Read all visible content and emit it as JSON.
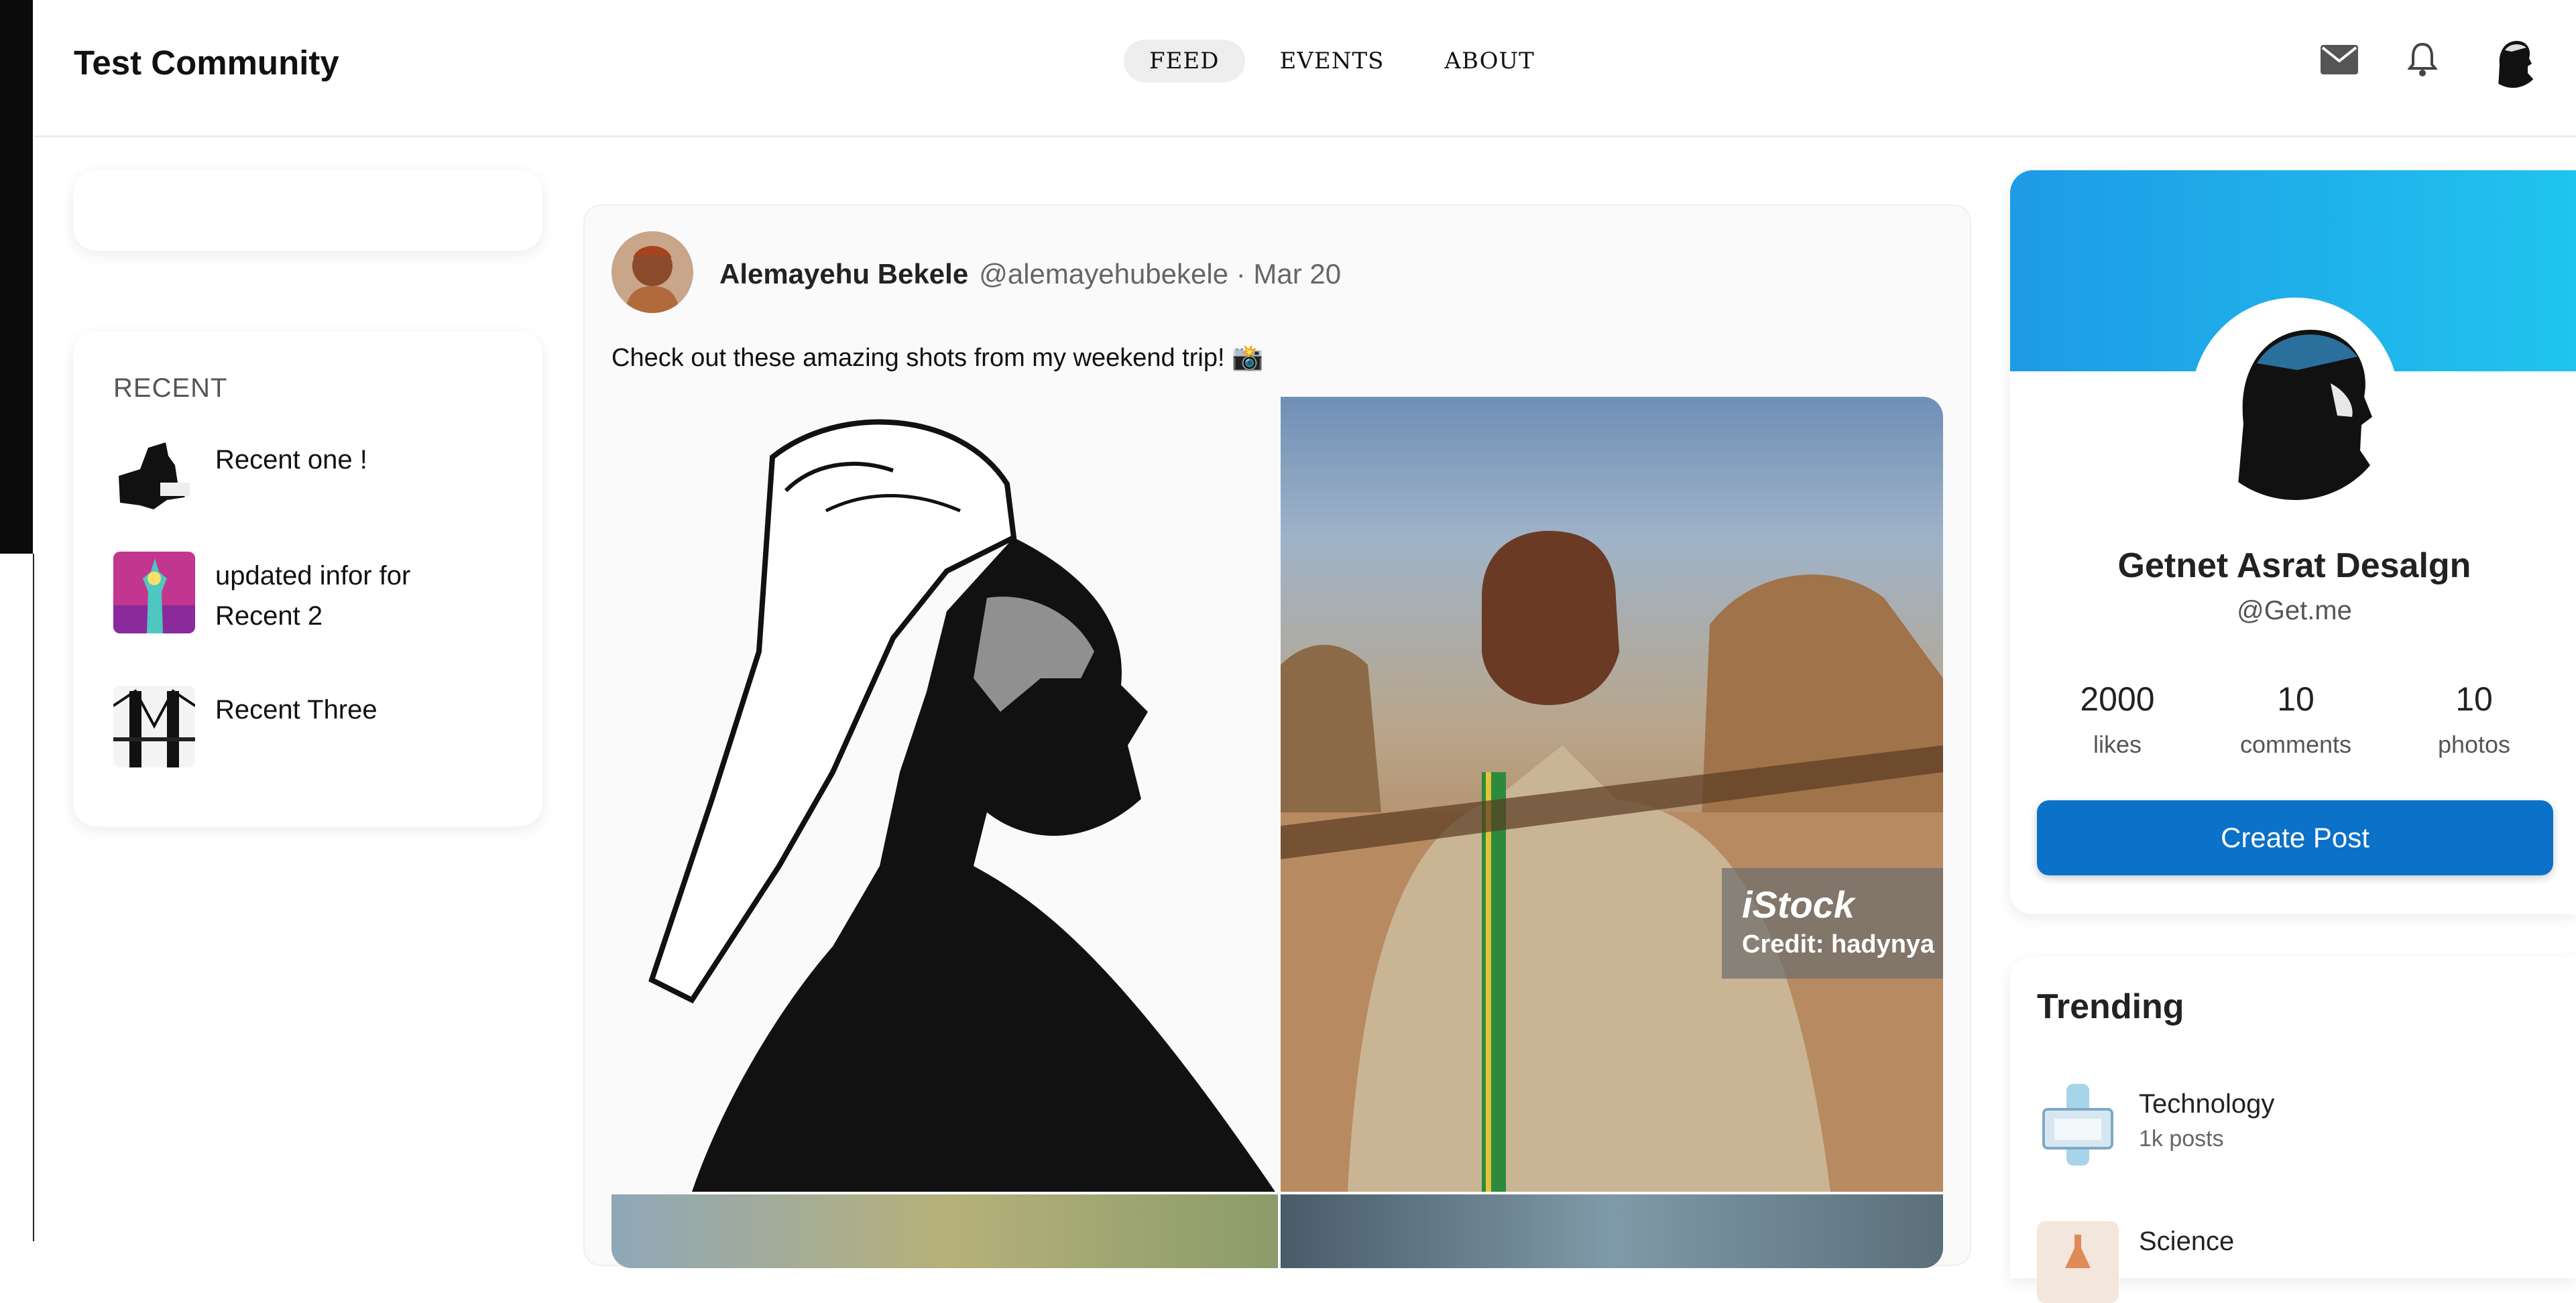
{
  "header": {
    "brand": "Test Community",
    "nav": [
      {
        "label": "FEED",
        "active": true
      },
      {
        "label": "EVENTS",
        "active": false
      },
      {
        "label": "ABOUT",
        "active": false
      }
    ],
    "icons": [
      "mail-icon",
      "bell-icon",
      "user-avatar"
    ]
  },
  "recent": {
    "title": "RECENT",
    "items": [
      {
        "label": "Recent one !"
      },
      {
        "label": "updated infor for Recent 2"
      },
      {
        "label": "Recent Three"
      }
    ]
  },
  "post": {
    "author": "Alemayehu Bekele",
    "handle": "@alemayehubekele",
    "separator": "·",
    "date": "Mar 20",
    "text": "Check out these amazing shots from my weekend trip! 📸",
    "watermark": {
      "brand": "iStock",
      "credit": "Credit: hadynya"
    }
  },
  "profile": {
    "name": "Getnet Asrat Desalgn",
    "handle": "@Get.me",
    "stats": [
      {
        "value": "2000",
        "label": "likes"
      },
      {
        "value": "10",
        "label": "comments"
      },
      {
        "value": "10",
        "label": "photos"
      }
    ],
    "create_post": "Create Post"
  },
  "trending": {
    "title": "Trending",
    "items": [
      {
        "name": "Technology",
        "posts": "1k posts"
      },
      {
        "name": "Science",
        "posts": ""
      }
    ]
  },
  "colors": {
    "accent": "#0b71c9",
    "banner_start": "#1e9be6",
    "banner_end": "#20c4ee"
  }
}
